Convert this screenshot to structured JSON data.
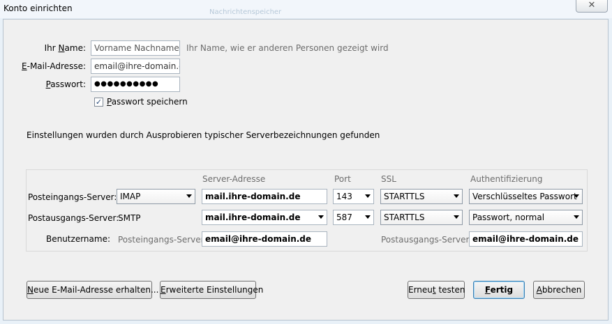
{
  "window": {
    "title": "Konto einrichten",
    "close_glyph": "✕",
    "bg_text": "Nachrichtenspeicher"
  },
  "identity": {
    "name_label_pre": "Ihr ",
    "name_label_u": "N",
    "name_label_post": "ame:",
    "name_placeholder": "Vorname Nachname",
    "name_hint": "Ihr Name, wie er anderen Personen gezeigt wird",
    "email_label_u": "E",
    "email_label_post": "-Mail-Adresse:",
    "email_value": "email@ihre-domain.de",
    "password_label_u": "P",
    "password_label_post": "asswort:",
    "password_value": "●●●●●●●●●●",
    "save_password_u": "P",
    "save_password_post": "asswort speichern",
    "save_password_checked": true,
    "check_glyph": "✓"
  },
  "status_message": "Einstellungen wurden durch Ausprobieren typischer Serverbezeichnungen gefunden",
  "servers": {
    "headers": {
      "server_address": "Server-Adresse",
      "port": "Port",
      "ssl": "SSL",
      "auth": "Authentifizierung"
    },
    "incoming": {
      "label": "Posteingangs-Server:",
      "protocol": "IMAP",
      "host": "mail.ihre-domain.de",
      "port": "143",
      "ssl": "STARTTLS",
      "auth": "Verschlüsseltes Passwort"
    },
    "outgoing": {
      "label": "Postausgangs-Server:",
      "protocol": "SMTP",
      "host": "mail.ihre-domain.de",
      "port": "587",
      "ssl": "STARTTLS",
      "auth": "Passwort, normal"
    },
    "username": {
      "label": "Benutzername:",
      "incoming_label": "Posteingangs-Server:",
      "incoming_value": "email@ihre-domain.de",
      "outgoing_label": "Postausgangs-Server:",
      "outgoing_value": "email@ihre-domain.de"
    }
  },
  "buttons": {
    "new_address_u": "N",
    "new_address_post": "eue E-Mail-Adresse erhalten...",
    "advanced_u": "E",
    "advanced_post": "rweiterte Einstellungen",
    "retest_pre": "Erneu",
    "retest_u": "t",
    "retest_post": " testen",
    "done_u": "F",
    "done_post": "ertig",
    "cancel_u": "A",
    "cancel_post": "bbrechen"
  }
}
